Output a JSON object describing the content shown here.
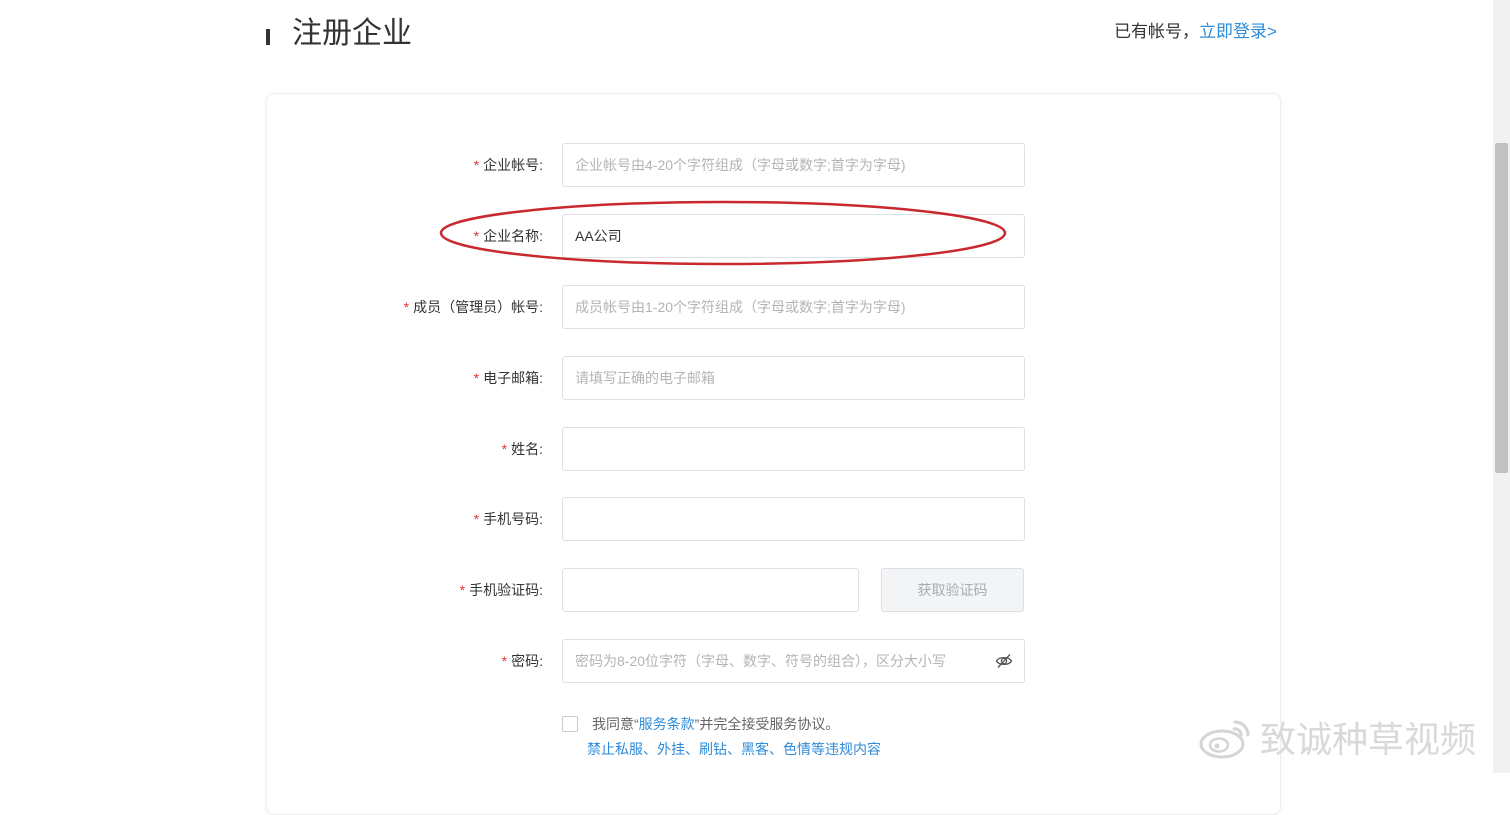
{
  "header": {
    "title": "注册企业",
    "login_prompt": "已有帐号，",
    "login_link": "立即登录>"
  },
  "form": {
    "fields": [
      {
        "label": "企业帐号:",
        "placeholder": "企业帐号由4-20个字符组成（字母或数字;首字为字母)",
        "value": ""
      },
      {
        "label": "企业名称:",
        "placeholder": "",
        "value": "AA公司"
      },
      {
        "label": "成员（管理员）帐号:",
        "placeholder": "成员帐号由1-20个字符组成（字母或数字;首字为字母)",
        "value": ""
      },
      {
        "label": "电子邮箱:",
        "placeholder": "请填写正确的电子邮箱",
        "value": ""
      },
      {
        "label": "姓名:",
        "placeholder": "",
        "value": ""
      },
      {
        "label": "手机号码:",
        "placeholder": "",
        "value": ""
      },
      {
        "label": "手机验证码:",
        "placeholder": "",
        "value": ""
      },
      {
        "label": "密码:",
        "placeholder": "密码为8-20位字符（字母、数字、符号的组合），区分大小写",
        "value": ""
      }
    ],
    "required_mark": "*",
    "get_code_button": "获取验证码",
    "agreement": {
      "prefix": "我同意“",
      "link": "服务条款",
      "suffix": "”并完全接受服务协议。",
      "rules_link": "禁止私服、外挂、刷钻、黑客、色情等违规内容"
    }
  },
  "watermark": {
    "text": "致诚种草视频"
  },
  "colors": {
    "link": "#2e8bd8",
    "required": "#e0362c",
    "annotation": "#c8282e"
  },
  "icons": [
    "eye-off-icon",
    "weibo-icon"
  ]
}
